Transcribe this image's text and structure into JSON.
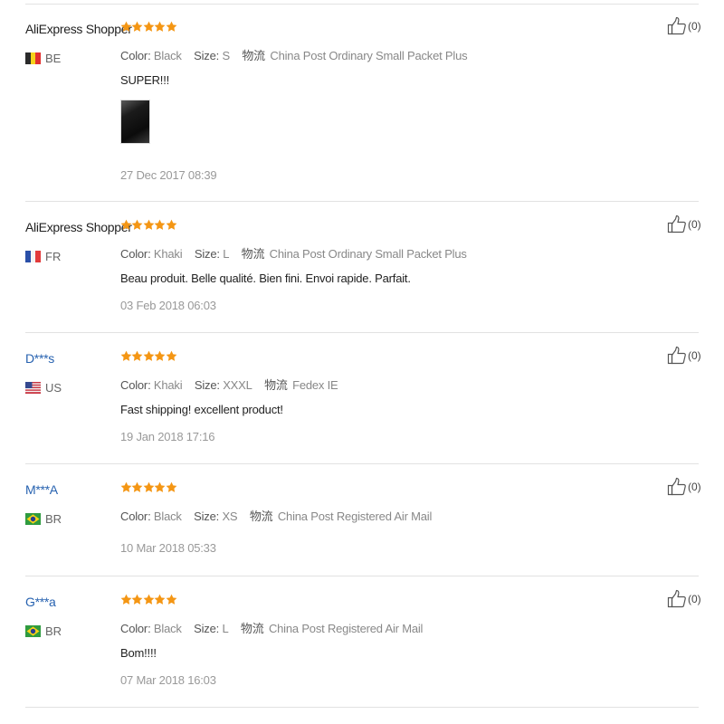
{
  "colors": {
    "star": "#f49614",
    "shopper_name": "#222222",
    "user_name": "#2762b0",
    "divider": "#e2e2e2"
  },
  "labels": {
    "color": "Color:",
    "size": "Size:",
    "shipping": "物流"
  },
  "reviews": [
    {
      "name": "AliExpress Shopper",
      "country": "BE",
      "flag_icon": "belgium-flag-icon",
      "rating": 5,
      "color": "Black",
      "size": "S",
      "shipping": "China Post Ordinary Small Packet Plus",
      "text": "SUPER!!!",
      "has_photo": true,
      "date": "27 Dec 2017 08:39",
      "helpful": "(0)"
    },
    {
      "name": "AliExpress Shopper",
      "country": "FR",
      "flag_icon": "france-flag-icon",
      "rating": 5,
      "color": "Khaki",
      "size": "L",
      "shipping": "China Post Ordinary Small Packet Plus",
      "text": "Beau produit. Belle qualité. Bien fini. Envoi rapide. Parfait.",
      "has_photo": false,
      "date": "03 Feb 2018 06:03",
      "helpful": "(0)"
    },
    {
      "name": "D***s",
      "country": "US",
      "flag_icon": "usa-flag-icon",
      "rating": 5,
      "color": "Khaki",
      "size": "XXXL",
      "shipping": "Fedex IE",
      "text": "Fast shipping! excellent product!",
      "has_photo": false,
      "date": "19 Jan 2018 17:16",
      "helpful": "(0)"
    },
    {
      "name": "M***A",
      "country": "BR",
      "flag_icon": "brazil-flag-icon",
      "rating": 5,
      "color": "Black",
      "size": "XS",
      "shipping": "China Post Registered Air Mail",
      "text": "",
      "has_photo": false,
      "date": "10 Mar 2018 05:33",
      "helpful": "(0)"
    },
    {
      "name": "G***a",
      "country": "BR",
      "flag_icon": "brazil-flag-icon",
      "rating": 5,
      "color": "Black",
      "size": "L",
      "shipping": "China Post Registered Air Mail",
      "text": "Bom!!!!",
      "has_photo": false,
      "date": "07 Mar 2018 16:03",
      "helpful": "(0)"
    }
  ]
}
